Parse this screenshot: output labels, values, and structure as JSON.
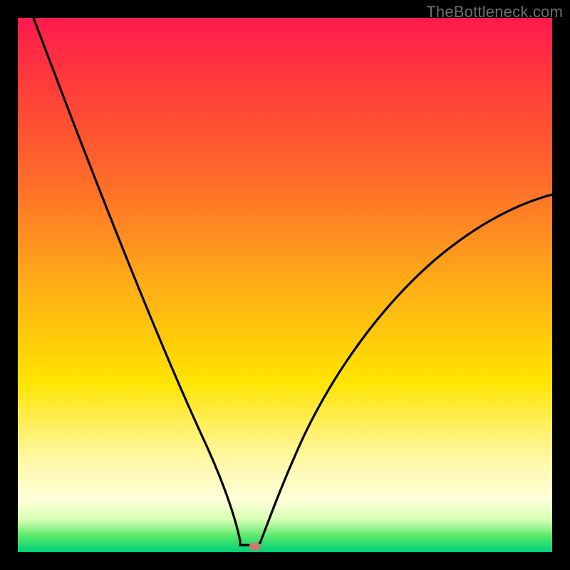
{
  "watermark": "TheBottleneck.com",
  "colors": {
    "frame": "#000000",
    "curve_stroke": "#000000",
    "marker_fill": "#cc7b6f",
    "gradient_stops": [
      "#ff1a4d",
      "#ff3b3b",
      "#ff6a2a",
      "#ffa719",
      "#ffe400",
      "#fff7a0",
      "#ffffd9",
      "#d6ffb3",
      "#57e86b",
      "#00d178"
    ]
  },
  "chart_data": {
    "type": "line",
    "title": "",
    "xlabel": "",
    "ylabel": "",
    "xlim": [
      0,
      100
    ],
    "ylim": [
      0,
      100
    ],
    "grid": false,
    "x": [
      3,
      10,
      15,
      20,
      25,
      30,
      35,
      38,
      40,
      41,
      42,
      43,
      44,
      45,
      48,
      52,
      58,
      65,
      72,
      80,
      88,
      95,
      100
    ],
    "values": [
      100,
      80,
      67,
      55,
      43,
      32,
      21,
      14,
      9,
      5,
      2,
      1,
      1,
      2,
      8,
      18,
      30,
      40,
      48,
      55,
      60,
      64,
      67
    ],
    "flat_segment": {
      "x_start": 40,
      "x_end": 45,
      "y": 1
    },
    "marker": {
      "x": 44,
      "y": 1
    }
  }
}
